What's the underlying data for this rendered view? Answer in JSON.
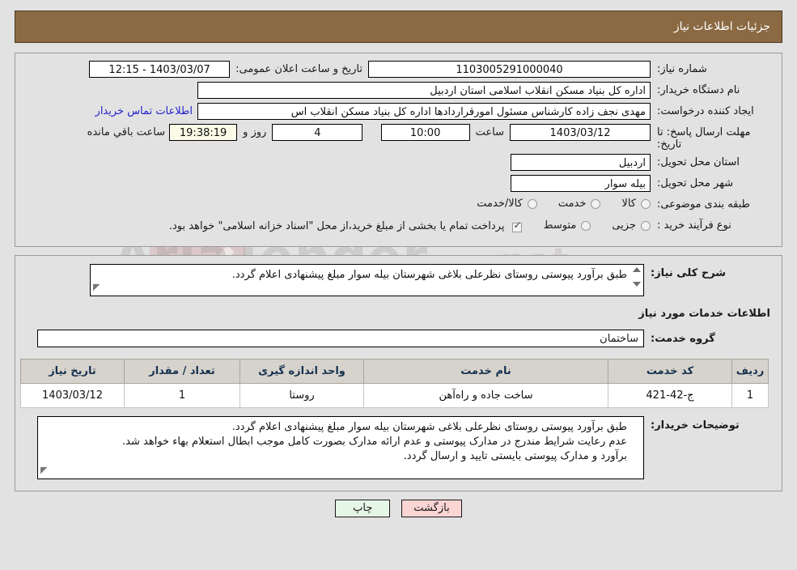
{
  "header": {
    "title": "جزئیات اطلاعات نیاز"
  },
  "form": {
    "need_number_label": "شماره نیاز:",
    "need_number_value": "1103005291000040",
    "announce_label": "تاریخ و ساعت اعلان عمومی:",
    "announce_value": "1403/03/07 - 12:15",
    "buyer_org_label": "نام دستگاه خریدار:",
    "buyer_org_value": "اداره کل بنیاد مسکن انقلاب اسلامی استان اردبیل",
    "creator_label": "ایجاد کننده درخواست:",
    "creator_value": "مهدی نجف زاده کارشناس مسئول امورقراردادها اداره کل بنیاد مسکن انقلاب اس",
    "contact_link": "اطلاعات تماس خریدار",
    "deadline_label": "مهلت ارسال پاسخ: تا تاریخ:",
    "deadline_date": "1403/03/12",
    "hour_label": "ساعت",
    "deadline_time": "10:00",
    "days_value": "4",
    "days_sep": "روز و",
    "countdown_value": "19:38:19",
    "countdown_suffix": "ساعت باقي مانده",
    "province_label": "استان محل تحویل:",
    "province_value": "اردبیل",
    "city_label": "شهر محل تحویل:",
    "city_value": "بیله سوار",
    "category_label": "طبقه بندی موضوعی:",
    "category_options": [
      {
        "label": "کالا",
        "selected": false
      },
      {
        "label": "خدمت",
        "selected": false
      },
      {
        "label": "کالا/خدمت",
        "selected": false
      }
    ],
    "process_label": "نوع فرآیند خرید :",
    "process_options": [
      {
        "label": "جزیی",
        "selected": false
      },
      {
        "label": "متوسط",
        "selected": false
      }
    ],
    "treasury_note": "پرداخت تمام یا بخشی از مبلغ خرید،از محل \"اسناد خزانه اسلامی\" خواهد بود.",
    "treasury_checked": true
  },
  "description": {
    "label": "شرح کلی نیاز:",
    "value": "طبق برآورد پیوستی روستای نظرعلی بلاغی شهرستان بیله سوار  مبلغ پیشنهادی اعلام گردد."
  },
  "services_section": {
    "title": "اطلاعات خدمات مورد نیاز",
    "group_label": "گروه خدمت:",
    "group_value": "ساختمان"
  },
  "table": {
    "columns": [
      "ردیف",
      "کد خدمت",
      "نام خدمت",
      "واحد اندازه گیری",
      "تعداد / مقدار",
      "تاریخ نیاز"
    ],
    "rows": [
      {
        "radif": "1",
        "code": "ج-42-421",
        "name": "ساخت جاده و راه‌آهن",
        "unit": "روستا",
        "qty": "1",
        "date": "1403/03/12"
      }
    ]
  },
  "buyer_notes": {
    "label": "توضیحات خریدار:",
    "line1": "طبق برآورد پیوستی روستای نظرعلی بلاغی شهرستان بیله سوار  مبلغ پیشنهادی اعلام گردد.",
    "line2": "عدم رعایت شرایط مندرج در مدارک پیوستی و عدم ارائه مدارک بصورت کامل موجب ابطال استعلام بهاء خواهد شد.",
    "line3": "برآورد و مدارک پیوستی بایستی تایید و ارسال گردد."
  },
  "footer": {
    "print_label": "چاپ",
    "back_label": "بازگشت"
  },
  "watermark": {
    "text": "AriaTender",
    "suffix": ".net"
  },
  "colors": {
    "header_bg": "#8b6a43",
    "page_bg": "#e2e2e2",
    "link": "#2222cc",
    "table_header_bg": "#d6d3cd",
    "table_header_text": "#16314f",
    "print_btn_bg": "#e6f6e6",
    "back_btn_bg": "#fbd4d4",
    "countdown_bg": "#fbfbe8"
  }
}
